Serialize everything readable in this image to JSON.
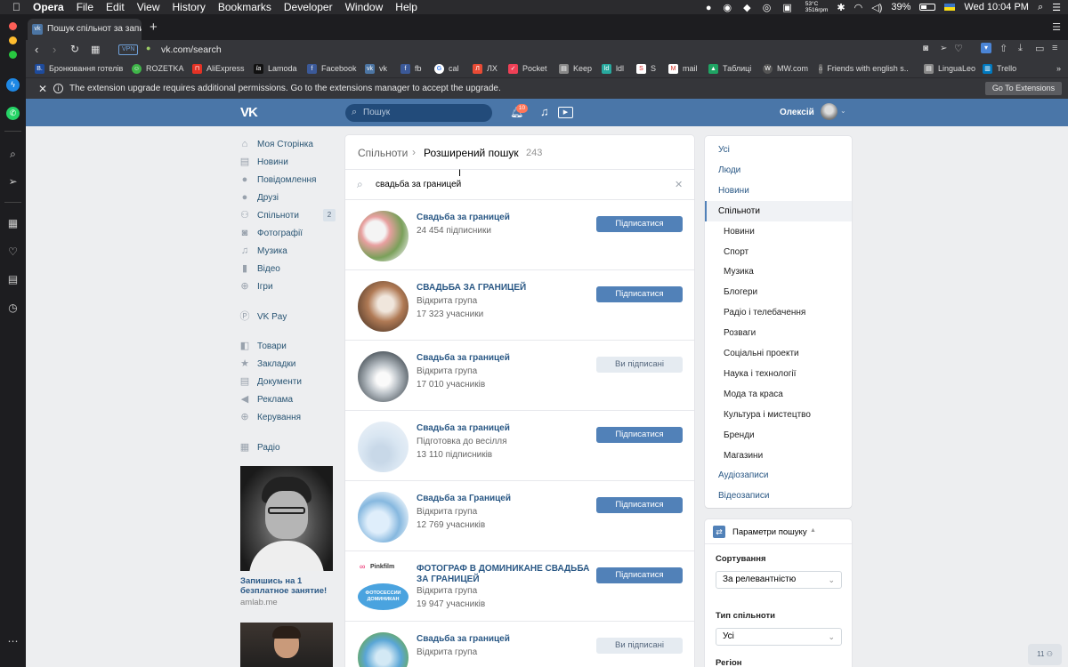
{
  "menubar": {
    "app": "Opera",
    "items": [
      "File",
      "Edit",
      "View",
      "History",
      "Bookmarks",
      "Developer",
      "Window",
      "Help"
    ],
    "weather_temp": "53°C",
    "weather_rpm": "3516rpm",
    "battery": "39%",
    "clock": "Wed 10:04 PM"
  },
  "browser": {
    "tab_title": "Пошук спільнот за запитом",
    "url": "vk.com/search",
    "vpn": "VPN",
    "bookmarks": [
      "Бронювання готелів",
      "ROZETKA",
      "AliExpress",
      "Lamoda",
      "Facebook",
      "vk",
      "fb",
      "cal",
      "ЛХ",
      "Pocket",
      "Keep",
      "ldl",
      "S",
      "mail",
      "Таблиці",
      "MW.com",
      "Friends with english s...",
      "LinguaLeo",
      "Trello"
    ],
    "ext_message": "The extension upgrade requires additional permissions. Go to the extensions manager to accept the upgrade.",
    "ext_button": "Go To Extensions"
  },
  "vk": {
    "search_placeholder": "Пошук",
    "notif_count": "10",
    "user_name": "Олексій",
    "left_nav": [
      {
        "label": "Моя Сторінка",
        "icon": "home-icon"
      },
      {
        "label": "Новини",
        "icon": "news-icon"
      },
      {
        "label": "Повідомлення",
        "icon": "message-icon"
      },
      {
        "label": "Друзі",
        "icon": "user-icon"
      },
      {
        "label": "Спільноти",
        "icon": "users-icon",
        "badge": "2"
      },
      {
        "label": "Фотографії",
        "icon": "camera-icon"
      },
      {
        "label": "Музика",
        "icon": "music-icon"
      },
      {
        "label": "Відео",
        "icon": "video-icon"
      },
      {
        "label": "Ігри",
        "icon": "gamepad-icon"
      }
    ],
    "left_nav2": [
      {
        "label": "VK Pay",
        "icon": "vkpay-icon"
      }
    ],
    "left_nav3": [
      {
        "label": "Товари",
        "icon": "bag-icon"
      },
      {
        "label": "Закладки",
        "icon": "star-icon"
      },
      {
        "label": "Документи",
        "icon": "document-icon"
      },
      {
        "label": "Реклама",
        "icon": "megaphone-icon"
      },
      {
        "label": "Керування",
        "icon": "gamepad-icon"
      }
    ],
    "left_nav4": [
      {
        "label": "Радіо",
        "icon": "grid-icon"
      }
    ],
    "ad": {
      "title": "Запишись на 1 безплатное занятие!",
      "domain": "amlab.me"
    },
    "breadcrumb": {
      "parent": "Спільноти",
      "current": "Розширений пошук",
      "count": "243"
    },
    "query": "свадьба за границей",
    "results": [
      {
        "name": "Свадьба за границей",
        "line2": "",
        "line3": "24 454 підписники",
        "button": "Підписатися",
        "subscribed": false
      },
      {
        "name": "СВАДЬБА ЗА ГРАНИЦЕЙ",
        "line2": "Відкрита група",
        "line3": "17 323 учасники",
        "button": "Підписатися",
        "subscribed": false
      },
      {
        "name": "Свадьба за границей",
        "line2": "Відкрита група",
        "line3": "17 010 учасників",
        "button": "Ви підписані",
        "subscribed": true
      },
      {
        "name": "Свадьба за границей",
        "line2": "Підготовка до весілля",
        "line3": "13 110 підписників",
        "button": "Підписатися",
        "subscribed": false
      },
      {
        "name": "Свадьба за Границей",
        "line2": "Відкрита група",
        "line3": "12 769 учасників",
        "button": "Підписатися",
        "subscribed": false
      },
      {
        "name": "ФОТОГРАФ В ДОМИНИКАНЕ СВАДЬБА ЗА ГРАНИЦЕЙ",
        "line2": "Відкрита група",
        "line3": "19 947 учасників",
        "button": "Підписатися",
        "subscribed": false
      },
      {
        "name": "Свадьба за границей",
        "line2": "Відкрита група",
        "line3": "",
        "button": "Ви підписані",
        "subscribed": true
      }
    ],
    "avatar_texts": {
      "pinkfilm": "Pinkfilm",
      "photosession": "ФОТОСЕССИИ ДОМИНИКАН"
    },
    "right_nav": [
      {
        "label": "Усі",
        "kind": "top"
      },
      {
        "label": "Люди",
        "kind": "top"
      },
      {
        "label": "Новини",
        "kind": "top"
      },
      {
        "label": "Спільноти",
        "kind": "active"
      },
      {
        "label": "Новини",
        "kind": "sub"
      },
      {
        "label": "Спорт",
        "kind": "sub"
      },
      {
        "label": "Музика",
        "kind": "sub"
      },
      {
        "label": "Блогери",
        "kind": "sub"
      },
      {
        "label": "Радіо і телебачення",
        "kind": "sub"
      },
      {
        "label": "Розваги",
        "kind": "sub"
      },
      {
        "label": "Соціальні проекти",
        "kind": "sub"
      },
      {
        "label": "Наука і технології",
        "kind": "sub"
      },
      {
        "label": "Мода та краса",
        "kind": "sub"
      },
      {
        "label": "Культура і мистецтво",
        "kind": "sub"
      },
      {
        "label": "Бренди",
        "kind": "sub"
      },
      {
        "label": "Магазини",
        "kind": "sub"
      },
      {
        "label": "Аудіозаписи",
        "kind": "top"
      },
      {
        "label": "Відеозаписи",
        "kind": "top"
      }
    ],
    "params": {
      "title": "Параметри пошуку",
      "sort_label": "Сортування",
      "sort_value": "За релевантністю",
      "type_label": "Тип спільноти",
      "type_value": "Усі",
      "region_label": "Регіон"
    },
    "chat_count": "11"
  },
  "colors": {
    "vk_blue": "#4a76a8",
    "link": "#2a5885",
    "button": "#5181b8"
  }
}
